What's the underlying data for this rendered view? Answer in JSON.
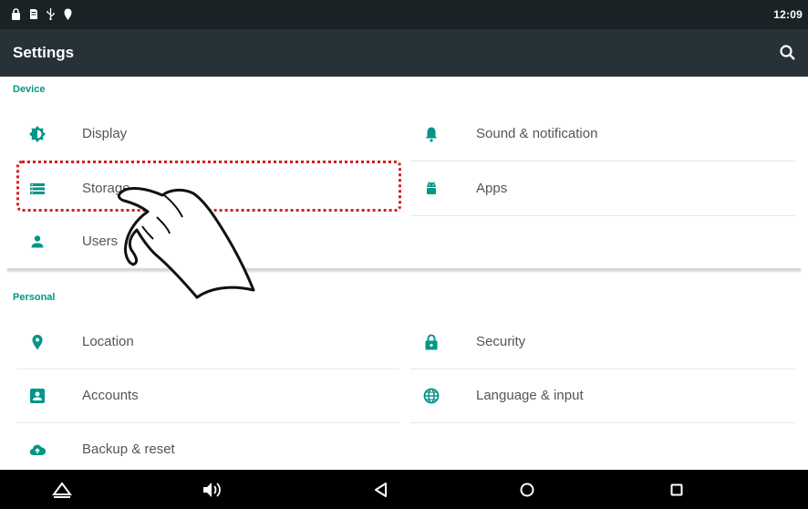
{
  "status_bar": {
    "time": "12:09",
    "icons": [
      "lock-icon",
      "sd-card-icon",
      "usb-icon",
      "location-pin-icon"
    ]
  },
  "app_bar": {
    "title": "Settings",
    "search_icon": "search-icon"
  },
  "sections": {
    "device": {
      "header": "Device",
      "items": [
        {
          "label": "Display",
          "icon": "brightness-icon"
        },
        {
          "label": "Sound & notification",
          "icon": "bell-icon"
        },
        {
          "label": "Storage",
          "icon": "storage-icon"
        },
        {
          "label": "Apps",
          "icon": "android-icon"
        },
        {
          "label": "Users",
          "icon": "person-icon"
        }
      ]
    },
    "personal": {
      "header": "Personal",
      "items": [
        {
          "label": "Location",
          "icon": "location-pin-icon"
        },
        {
          "label": "Security",
          "icon": "lock-icon"
        },
        {
          "label": "Accounts",
          "icon": "account-box-icon"
        },
        {
          "label": "Language & input",
          "icon": "globe-icon"
        },
        {
          "label": "Backup & reset",
          "icon": "cloud-upload-icon"
        }
      ]
    }
  },
  "nav_bar": {
    "buttons": [
      "collapse-icon",
      "volume-icon",
      "back-icon",
      "home-icon",
      "recents-icon"
    ]
  },
  "colors": {
    "status_bar": "#1b2226",
    "app_bar": "#263238",
    "accent": "#009688",
    "highlight": "#d32020",
    "nav_bar": "#000000"
  }
}
